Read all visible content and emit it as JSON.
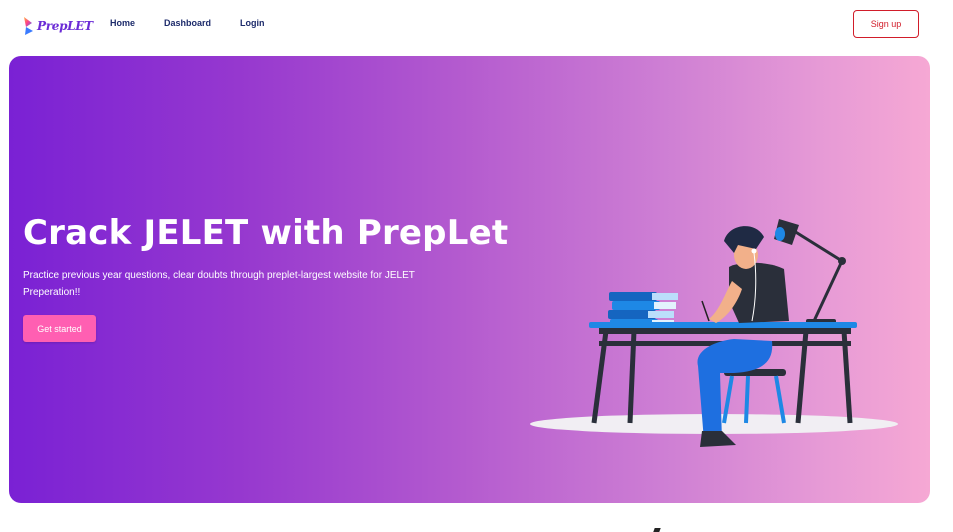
{
  "brand": {
    "logo_text": "PrepLET",
    "name": "PrepLet"
  },
  "nav": {
    "items": [
      {
        "label": "Home"
      },
      {
        "label": "Dashboard"
      },
      {
        "label": "Login"
      }
    ],
    "signup_label": "Sign up"
  },
  "hero": {
    "title": "Crack JELET with PrepLet",
    "subtitle": "Practice previous year questions, clear doubts through preplet-largest website for JELET Preperation!!",
    "cta_label": "Get started",
    "illustration": "student-studying-at-desk-illustration"
  },
  "colors": {
    "gradient_start": "#7a21d4",
    "gradient_end": "#f6a8d4",
    "cta": "#ff5fb2",
    "signup_border": "#d11d2a",
    "nav_text": "#1d2b6b"
  }
}
